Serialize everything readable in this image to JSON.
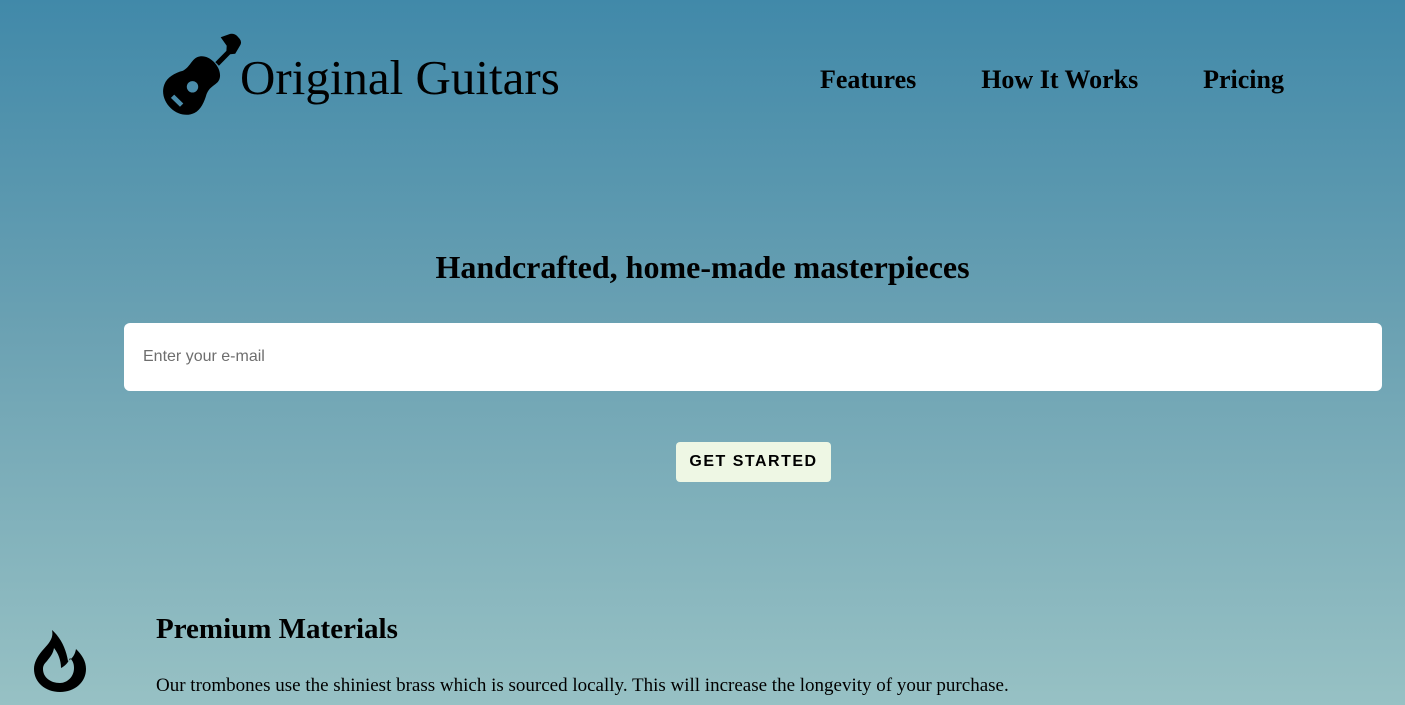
{
  "header": {
    "brand": {
      "icon": "guitar-icon",
      "name": "Original Guitars"
    },
    "nav": [
      {
        "label": "Features"
      },
      {
        "label": "How It Works"
      },
      {
        "label": "Pricing"
      }
    ]
  },
  "hero": {
    "title": "Handcrafted, home-made masterpieces",
    "email_placeholder": "Enter your e-mail",
    "email_value": "",
    "cta_label": "GET STARTED"
  },
  "features": [
    {
      "icon": "flame-icon",
      "title": "Premium Materials",
      "description": "Our trombones use the shiniest brass which is sourced locally. This will increase the longevity of your purchase."
    }
  ],
  "colors": {
    "background_top": "#4189a9",
    "background_bottom": "#97c1c4",
    "button_bg": "#eef7e4",
    "input_bg": "#ffffff",
    "text": "#000000"
  }
}
